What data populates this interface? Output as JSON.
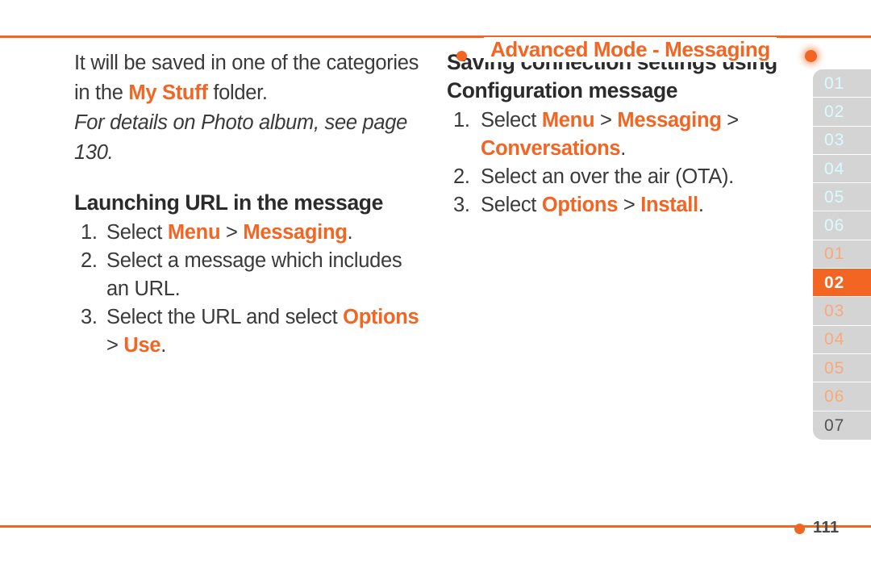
{
  "header": {
    "title": "Advanced Mode - Messaging",
    "dot_left_icon": "bullet-dot-icon",
    "dot_right_icon": "bullet-dot-glow-icon"
  },
  "colors": {
    "accent": "#f26522",
    "body_text": "#3a3a3a",
    "tab_bg": "#d4d4d4",
    "tab_active_bg": "#f26522",
    "tab_label_cyan": "#d8fbff",
    "tab_label_peach": "#f9a97a",
    "tab_label_gray": "#555555"
  },
  "left_column": {
    "intro": {
      "part1": "It will be saved in one of the categories in the ",
      "highlight": "My Stuff",
      "part2": " folder."
    },
    "intro_italic": "For details on Photo album, see page 130.",
    "heading": "Launching URL in the message",
    "steps": [
      {
        "pre": "Select ",
        "token1": "Menu",
        "sep": " > ",
        "token2": "Messaging",
        "post": "."
      },
      {
        "pre": "Select a message which includes an URL.",
        "token1": "",
        "sep": "",
        "token2": "",
        "post": ""
      },
      {
        "pre": "Select the URL and select ",
        "token1": "Options",
        "sep": " > ",
        "token2": "Use",
        "post": "."
      }
    ]
  },
  "right_column": {
    "heading": "Saving connection settings using Configuration message",
    "steps": [
      {
        "pre": "Select ",
        "token1": "Menu",
        "sep": " > ",
        "token2": "Messaging",
        "sep2": " > ",
        "token3": "Conversations",
        "post": "."
      },
      {
        "pre": "Select an over the air (OTA).",
        "token1": "",
        "sep": "",
        "token2": "",
        "sep2": "",
        "token3": "",
        "post": ""
      },
      {
        "pre": "Select ",
        "token1": "Options",
        "sep": " > ",
        "token2": "Install",
        "sep2": "",
        "token3": "",
        "post": "."
      }
    ]
  },
  "tabstrip": [
    {
      "label": "01",
      "style": "section-a",
      "active": false
    },
    {
      "label": "02",
      "style": "section-a",
      "active": false
    },
    {
      "label": "03",
      "style": "section-a",
      "active": false
    },
    {
      "label": "04",
      "style": "section-a",
      "active": false
    },
    {
      "label": "05",
      "style": "section-a",
      "active": false
    },
    {
      "label": "06",
      "style": "section-a",
      "active": false
    },
    {
      "label": "01",
      "style": "section-b",
      "active": false
    },
    {
      "label": "02",
      "style": "section-b",
      "active": true
    },
    {
      "label": "03",
      "style": "section-b",
      "active": false
    },
    {
      "label": "04",
      "style": "section-b",
      "active": false
    },
    {
      "label": "05",
      "style": "section-b",
      "active": false
    },
    {
      "label": "06",
      "style": "section-b",
      "active": false
    },
    {
      "label": "07",
      "style": "plain",
      "active": false
    }
  ],
  "footer": {
    "page_number": "111",
    "dot_icon": "bullet-dot-icon"
  }
}
